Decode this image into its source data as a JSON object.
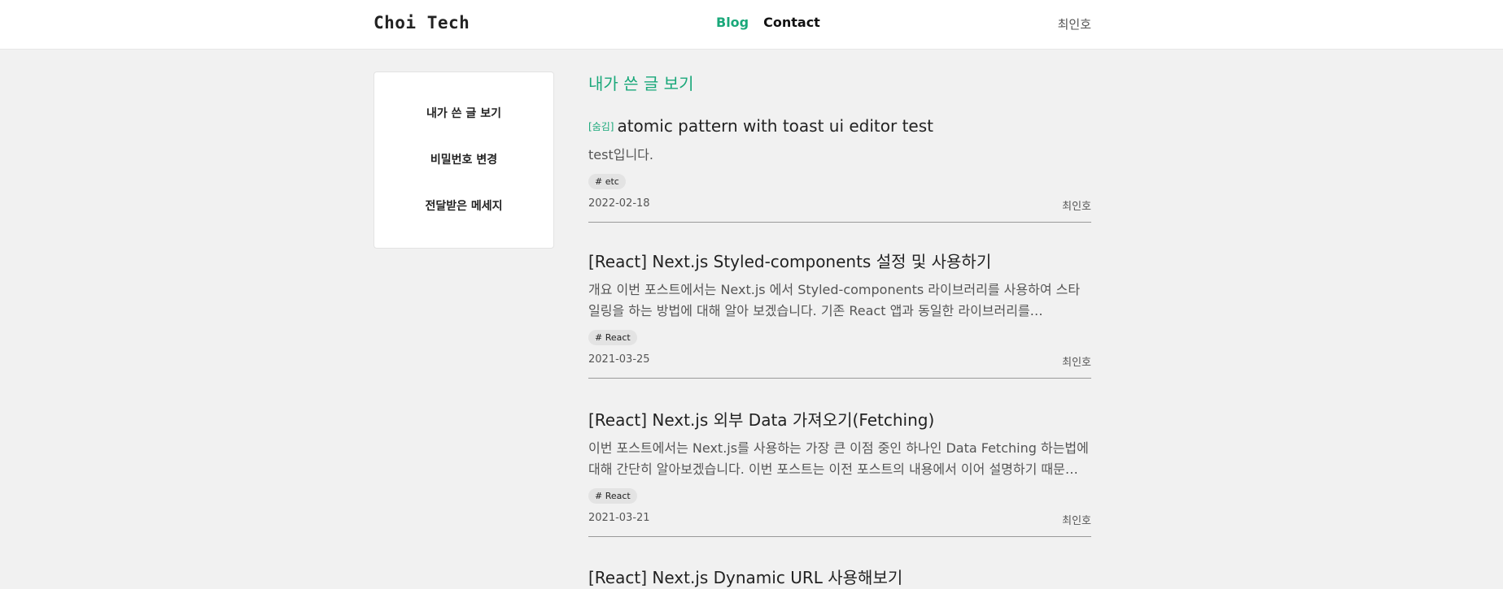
{
  "header": {
    "logo": "Choi Tech",
    "nav": [
      {
        "label": "Blog",
        "active": true
      },
      {
        "label": "Contact",
        "active": false
      }
    ],
    "user": "최인호"
  },
  "sidebar": {
    "items": [
      {
        "label": "내가 쓴 글 보기"
      },
      {
        "label": "비밀번호 변경"
      },
      {
        "label": "전달받은 메세지"
      }
    ]
  },
  "main": {
    "section_title": "내가 쓴 글 보기",
    "posts": [
      {
        "hidden_label": "[숨김]",
        "title": "atomic pattern with toast ui editor test",
        "summary": "test입니다.",
        "tag": "# etc",
        "date": "2022-02-18",
        "author": "최인호"
      },
      {
        "hidden_label": "",
        "title": "[React] Next.js Styled-components 설정 및 사용하기",
        "summary": "개요 이번 포스트에서는 Next.js 에서 Styled-components 라이브러리를 사용하여 스타일링을 하는 방법에 대해 알아 보겠습니다. 기존 React 앱과 동일한 라이브러리를…",
        "tag": "# React",
        "date": "2021-03-25",
        "author": "최인호"
      },
      {
        "hidden_label": "",
        "title": "[React] Next.js 외부 Data 가져오기(Fetching)",
        "summary": "이번 포스트에서는 Next.js를 사용하는 가장 큰 이점 중인 하나인 Data Fetching 하는법에 대해 간단히 알아보겠습니다. 이번 포스트는 이전 포스트의 내용에서 이어 설명하기 때문에,…",
        "tag": "# React",
        "date": "2021-03-21",
        "author": "최인호"
      },
      {
        "hidden_label": "",
        "title": "[React] Next.js Dynamic URL 사용해보기",
        "summary": "",
        "tag": "",
        "date": "",
        "author": ""
      }
    ]
  },
  "colors": {
    "accent": "#1aa87a",
    "background": "#f1f1f1"
  }
}
